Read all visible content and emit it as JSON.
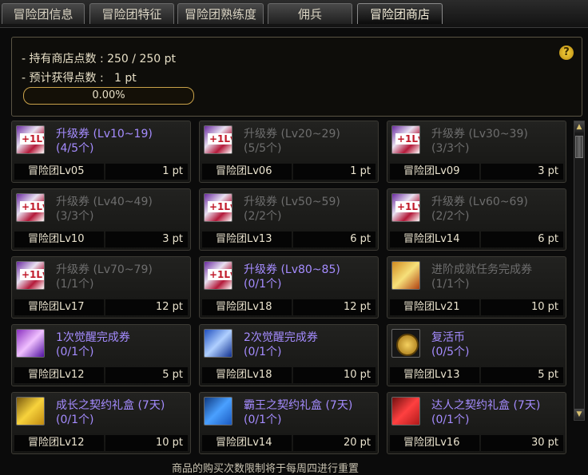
{
  "tabs": [
    {
      "label": "冒险团信息",
      "active": false
    },
    {
      "label": "冒险团特征",
      "active": false
    },
    {
      "label": "冒险团熟练度",
      "active": false
    },
    {
      "label": "佣兵",
      "active": false
    },
    {
      "label": "冒险团商店",
      "active": true
    }
  ],
  "header": {
    "points_line": "- 持有商店点数 : 250 / 250 pt",
    "expected_line": "- 预计获得点数 :   1 pt",
    "progress_text": "0.00%",
    "progress_value": 0.0,
    "help_icon": "?"
  },
  "items": [
    {
      "name": "升级券 (Lv10~19)",
      "count": "(4/5个)",
      "level": "冒险团Lv05",
      "price": "1 pt",
      "available": true,
      "icon": "ticket"
    },
    {
      "name": "升级券 (Lv20~29)",
      "count": "(5/5个)",
      "level": "冒险团Lv06",
      "price": "1 pt",
      "available": false,
      "icon": "ticket"
    },
    {
      "name": "升级券 (Lv30~39)",
      "count": "(3/3个)",
      "level": "冒险团Lv09",
      "price": "3 pt",
      "available": false,
      "icon": "ticket"
    },
    {
      "name": "升级券 (Lv40~49)",
      "count": "(3/3个)",
      "level": "冒险团Lv10",
      "price": "3 pt",
      "available": false,
      "icon": "ticket"
    },
    {
      "name": "升级券 (Lv50~59)",
      "count": "(2/2个)",
      "level": "冒险团Lv13",
      "price": "6 pt",
      "available": false,
      "icon": "ticket"
    },
    {
      "name": "升级券 (Lv60~69)",
      "count": "(2/2个)",
      "level": "冒险团Lv14",
      "price": "6 pt",
      "available": false,
      "icon": "ticket"
    },
    {
      "name": "升级券 (Lv70~79)",
      "count": "(1/1个)",
      "level": "冒险团Lv17",
      "price": "12 pt",
      "available": false,
      "icon": "ticket"
    },
    {
      "name": "升级券 (Lv80~85)",
      "count": "(0/1个)",
      "level": "冒险团Lv18",
      "price": "12 pt",
      "available": true,
      "icon": "ticket"
    },
    {
      "name": "进阶成就任务完成券",
      "count": "(1/1个)",
      "level": "冒险团Lv21",
      "price": "10 pt",
      "available": false,
      "icon": "achv"
    },
    {
      "name": "1次觉醒完成券",
      "count": "(0/1个)",
      "level": "冒险团Lv12",
      "price": "5 pt",
      "available": true,
      "icon": "awake1"
    },
    {
      "name": "2次觉醒完成券",
      "count": "(0/1个)",
      "level": "冒险团Lv18",
      "price": "10 pt",
      "available": true,
      "icon": "awake2"
    },
    {
      "name": "复活币",
      "count": "(0/5个)",
      "level": "冒险团Lv13",
      "price": "5 pt",
      "available": true,
      "icon": "coin"
    },
    {
      "name": "成长之契约礼盒 (7天)",
      "count": "(0/1个)",
      "level": "冒险团Lv12",
      "price": "10 pt",
      "available": true,
      "icon": "box-gold"
    },
    {
      "name": "霸王之契约礼盒 (7天)",
      "count": "(0/1个)",
      "level": "冒险团Lv14",
      "price": "20 pt",
      "available": true,
      "icon": "box-blue"
    },
    {
      "name": "达人之契约礼盒 (7天)",
      "count": "(0/1个)",
      "level": "冒险团Lv16",
      "price": "30 pt",
      "available": true,
      "icon": "box-red"
    }
  ],
  "footer_notice": "商品的购买次数限制将于每周四进行重置"
}
